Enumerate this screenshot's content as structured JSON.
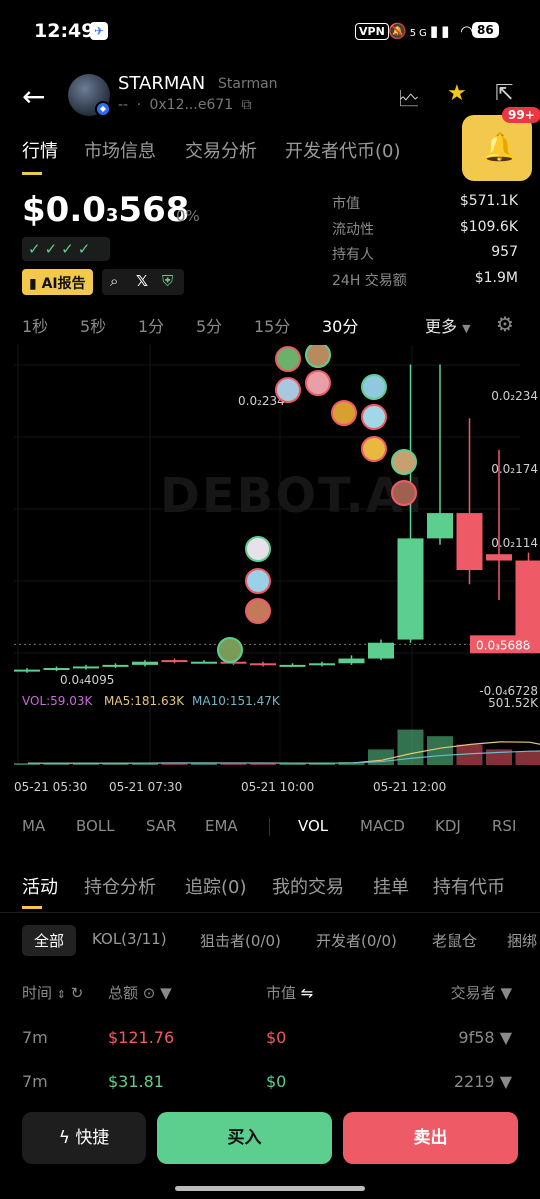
{
  "status_bar": {
    "time": "12:49",
    "vpn": "VPN",
    "network": "5G",
    "battery": "86"
  },
  "header": {
    "token_name": "STARMAN",
    "token_sub": "Starman",
    "dashes": "--",
    "address": "0x12...e671",
    "notifications_badge": "99+"
  },
  "main_tabs": [
    "行情",
    "市场信息",
    "交易分析",
    "开发者代币(0)"
  ],
  "price": {
    "prefix": "$0.0",
    "subscript": "3",
    "suffix": "568",
    "change": "0%",
    "checks": "✓✓✓✓",
    "ai_report": "AI报告"
  },
  "stats": [
    {
      "label": "市值",
      "value": "$571.1K"
    },
    {
      "label": "流动性",
      "value": "$109.6K"
    },
    {
      "label": "持有人",
      "value": "957"
    },
    {
      "label": "24H 交易额",
      "value": "$1.9M"
    }
  ],
  "timeframes": [
    "1秒",
    "5秒",
    "1分",
    "5分",
    "15分",
    "30分"
  ],
  "timeframe_active": "30分",
  "timeframe_more": "更多",
  "chart_data": {
    "type": "candlestick",
    "price_axis_labels": [
      "0.0₂234",
      "0.0₂174",
      "0.0₂114",
      "0.0₃5688",
      "-0.0₄6728"
    ],
    "current_price_label": "0.0₃5688",
    "high_label": "0.0₂234",
    "low_label": "0.0₄4095",
    "volume_axis_label": "501.52K",
    "x_labels": [
      "05-21 05:30",
      "05-21 07:30",
      "05-21 10:00",
      "05-21 12:00"
    ],
    "watermark": "DEBOT.AI",
    "volume_legend": {
      "vol": "VOL:59.03K",
      "ma5": "MA5:181.63K",
      "ma10": "MA10:151.47K"
    },
    "candles": [
      {
        "o": 0.4,
        "c": 0.41,
        "h": 0.42,
        "l": 0.39
      },
      {
        "o": 0.41,
        "c": 0.42,
        "h": 0.43,
        "l": 0.4
      },
      {
        "o": 0.42,
        "c": 0.43,
        "h": 0.44,
        "l": 0.41
      },
      {
        "o": 0.43,
        "c": 0.44,
        "h": 0.45,
        "l": 0.42
      },
      {
        "o": 0.44,
        "c": 0.46,
        "h": 0.47,
        "l": 0.43
      },
      {
        "o": 0.47,
        "c": 0.46,
        "h": 0.48,
        "l": 0.45
      },
      {
        "o": 0.46,
        "c": 0.46,
        "h": 0.47,
        "l": 0.45
      },
      {
        "o": 0.46,
        "c": 0.45,
        "h": 0.47,
        "l": 0.44
      },
      {
        "o": 0.45,
        "c": 0.44,
        "h": 0.46,
        "l": 0.43
      },
      {
        "o": 0.44,
        "c": 0.44,
        "h": 0.45,
        "l": 0.43
      },
      {
        "o": 0.44,
        "c": 0.45,
        "h": 0.46,
        "l": 0.43
      },
      {
        "o": 0.45,
        "c": 0.48,
        "h": 0.5,
        "l": 0.44
      },
      {
        "o": 0.48,
        "c": 0.58,
        "h": 0.6,
        "l": 0.47
      },
      {
        "o": 0.6,
        "c": 1.24,
        "h": 2.34,
        "l": 0.58
      },
      {
        "o": 1.24,
        "c": 1.4,
        "h": 2.34,
        "l": 1.2
      },
      {
        "o": 1.4,
        "c": 1.04,
        "h": 2.0,
        "l": 0.95
      },
      {
        "o": 1.14,
        "c": 1.1,
        "h": 1.8,
        "l": 0.85
      },
      {
        "o": 1.1,
        "c": 0.62,
        "h": 1.15,
        "l": 0.58
      },
      {
        "o": 0.63,
        "c": 0.57,
        "h": 0.68,
        "l": 0.55
      }
    ],
    "volumes": [
      0.03,
      0.03,
      0.03,
      0.03,
      0.04,
      0.04,
      0.03,
      0.03,
      0.03,
      0.03,
      0.03,
      0.05,
      0.26,
      0.59,
      0.48,
      0.34,
      0.26,
      0.23,
      0.12
    ]
  },
  "indicator_tabs": [
    "MA",
    "BOLL",
    "SAR",
    "EMA",
    "VOL",
    "MACD",
    "KDJ",
    "RSI"
  ],
  "indicator_active": "VOL",
  "activity_tabs": [
    "活动",
    "持仓分析",
    "追踪(0)",
    "我的交易",
    "挂单",
    "持有代币"
  ],
  "filter_chips": [
    "全部",
    "KOL(3/11)",
    "狙击者(0/0)",
    "开发者(0/0)",
    "老鼠仓",
    "捆绑"
  ],
  "table": {
    "headers": {
      "time": "时间",
      "amount": "总额",
      "mcap": "市值",
      "trader": "交易者"
    },
    "rows": [
      {
        "time": "7m",
        "amount": "$121.76",
        "mcap": "$0",
        "trader": "9f58",
        "side": "sell"
      },
      {
        "time": "7m",
        "amount": "$31.81",
        "mcap": "$0",
        "trader": "2219",
        "side": "buy"
      }
    ]
  },
  "actions": {
    "quick": "快捷",
    "buy": "买入",
    "sell": "卖出"
  },
  "colors": {
    "up": "#5ccf8f",
    "down": "#ee5b67",
    "accent": "#f2c94c"
  }
}
